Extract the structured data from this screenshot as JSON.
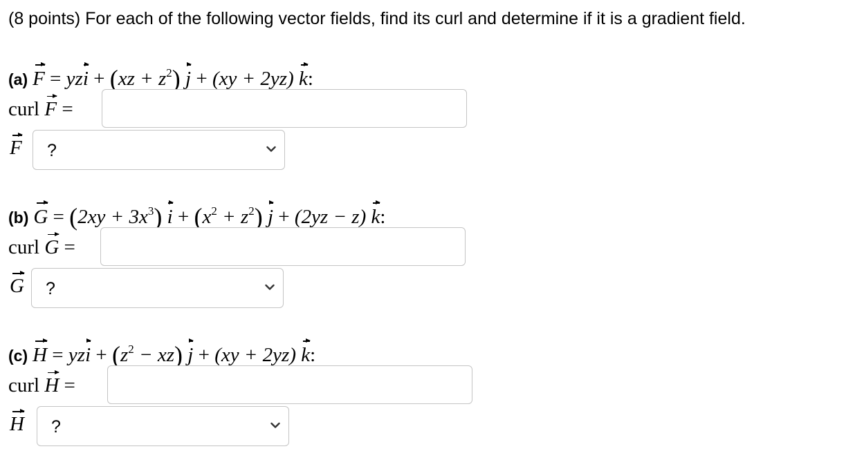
{
  "header": "(8 points) For each of the following vector fields, find its curl and determine if it is a gradient field.",
  "parts": [
    {
      "label": "(a)",
      "field_letter": "F",
      "eq": "=",
      "i_coef": "yz",
      "j_coef_inner": "xz + z",
      "j_exp": "2",
      "k_coef": "(xy + 2yz)",
      "curl_word": "curl",
      "curl_value": "",
      "select_value": "?"
    },
    {
      "label": "(b)",
      "field_letter": "G",
      "eq": "=",
      "i_coef_a": "2xy + 3x",
      "i_exp": "3",
      "j_coef_a": "x",
      "j_exp_a": "2",
      "j_coef_b": " + z",
      "j_exp_b": "2",
      "k_coef": "(2yz − z)",
      "curl_word": "curl",
      "curl_value": "",
      "select_value": "?"
    },
    {
      "label": "(c)",
      "field_letter": "H",
      "eq": "=",
      "i_coef": "yz",
      "j_coef_a": "z",
      "j_exp": "2",
      "j_coef_b": " − xz",
      "k_coef": "(xy + 2yz)",
      "curl_word": "curl",
      "curl_value": "",
      "select_value": "?"
    }
  ],
  "symbols": {
    "plus": "+",
    "i": "i",
    "j": "j",
    "k": "k",
    "colon": ":",
    "lparen": "(",
    "rparen": ")"
  }
}
